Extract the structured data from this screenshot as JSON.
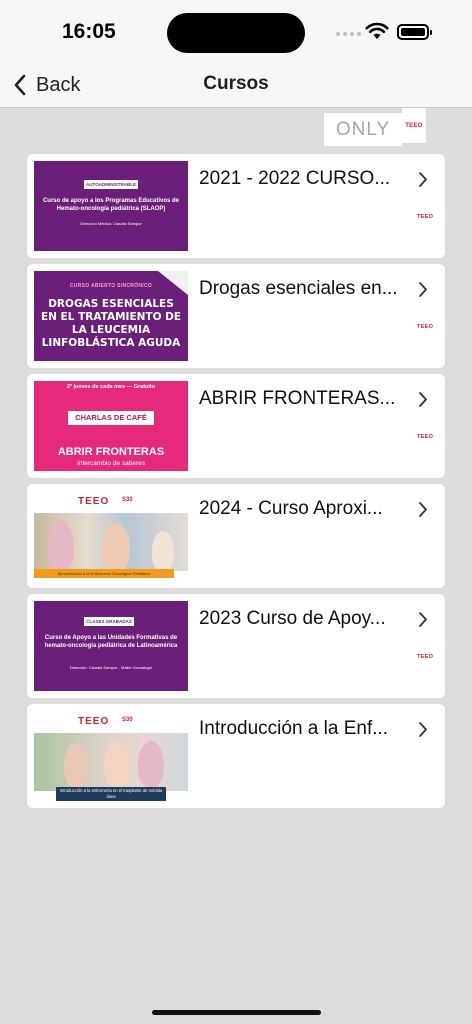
{
  "status_bar": {
    "time": "16:05"
  },
  "nav": {
    "back_label": "Back",
    "title": "Cursos"
  },
  "badge": {
    "only": "ONLY",
    "logo": "TEEO"
  },
  "courses": [
    {
      "title": "2021 - 2022 CURSO...",
      "logo": "TEEO",
      "thumb": {
        "tag": "AUTOADMINISTRABLE",
        "heading": "Curso de apoyo a los Programas Educativos de Hemato-oncología pediátrica (SLAOP)",
        "subtitle": "Dirección Médica: Claudia Sampor"
      }
    },
    {
      "title": "Drogas esenciales en...",
      "logo": "TEEO",
      "thumb": {
        "tag": "CURSO ABIERTO SINCRÓNICO",
        "heading": "DROGAS ESENCIALES EN EL TRATAMIENTO DE LA LEUCEMIA LINFOBLÁSTICA AGUDA"
      }
    },
    {
      "title": "ABRIR FRONTERAS...",
      "logo": "TEEO",
      "thumb": {
        "top": "2º jueves de cada mes — Gratuito",
        "pill": "CHARLAS DE CAFÉ",
        "heading": "ABRIR FRONTERAS",
        "subtitle": "Intercambio de saberes"
      }
    },
    {
      "title": "2024 - Curso Aproxi...",
      "logo": "",
      "thumb": {
        "brand": "TEEO",
        "seal": "S30",
        "caption": "Aproximación a la Enfermería Oncológica Pediátrica"
      }
    },
    {
      "title": "2023 Curso de Apoy...",
      "logo": "TEEO",
      "thumb": {
        "tag": "CLASES GRABADAS",
        "heading": "Curso de Apoyo a las Unidades Formativas de hemato-oncología pediátrica de Latinoamérica",
        "subtitle": "Dirección: Claudia Sampor - Mailie Gorostegui"
      }
    },
    {
      "title": "Introducción a la Enf...",
      "logo": "",
      "thumb": {
        "brand": "TEEO",
        "seal": "S30",
        "caption": "Introducción a la enfermería en el trasplante de médula ósea"
      }
    }
  ],
  "colors": {
    "purple": "#6c1f7a",
    "pink": "#e52a7c",
    "orange": "#f39b1c",
    "navy": "#1f3b5c",
    "brand_red": "#d4202f"
  }
}
